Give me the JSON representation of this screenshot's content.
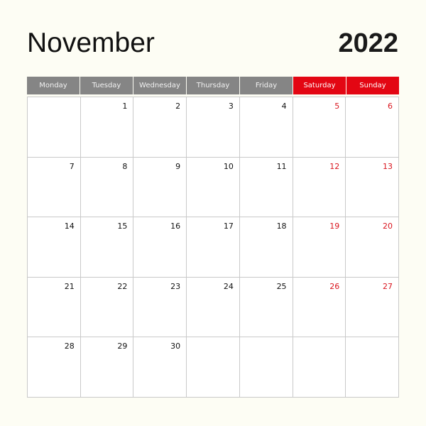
{
  "title": {
    "month": "November",
    "year": "2022"
  },
  "colors": {
    "header_weekday": "#858585",
    "header_weekend": "#e30613",
    "weekend_text": "#d9141d",
    "grid_line": "#c9c9c9",
    "background": "#fdfdf4"
  },
  "weekdays": [
    {
      "label": "Monday",
      "weekend": false
    },
    {
      "label": "Tuesday",
      "weekend": false
    },
    {
      "label": "Wednesday",
      "weekend": false
    },
    {
      "label": "Thursday",
      "weekend": false
    },
    {
      "label": "Friday",
      "weekend": false
    },
    {
      "label": "Saturday",
      "weekend": true
    },
    {
      "label": "Sunday",
      "weekend": true
    }
  ],
  "weeks": [
    [
      "",
      "1",
      "2",
      "3",
      "4",
      "5",
      "6"
    ],
    [
      "7",
      "8",
      "9",
      "10",
      "11",
      "12",
      "13"
    ],
    [
      "14",
      "15",
      "16",
      "17",
      "18",
      "19",
      "20"
    ],
    [
      "21",
      "22",
      "23",
      "24",
      "25",
      "26",
      "27"
    ],
    [
      "28",
      "29",
      "30",
      "",
      "",
      "",
      ""
    ]
  ]
}
